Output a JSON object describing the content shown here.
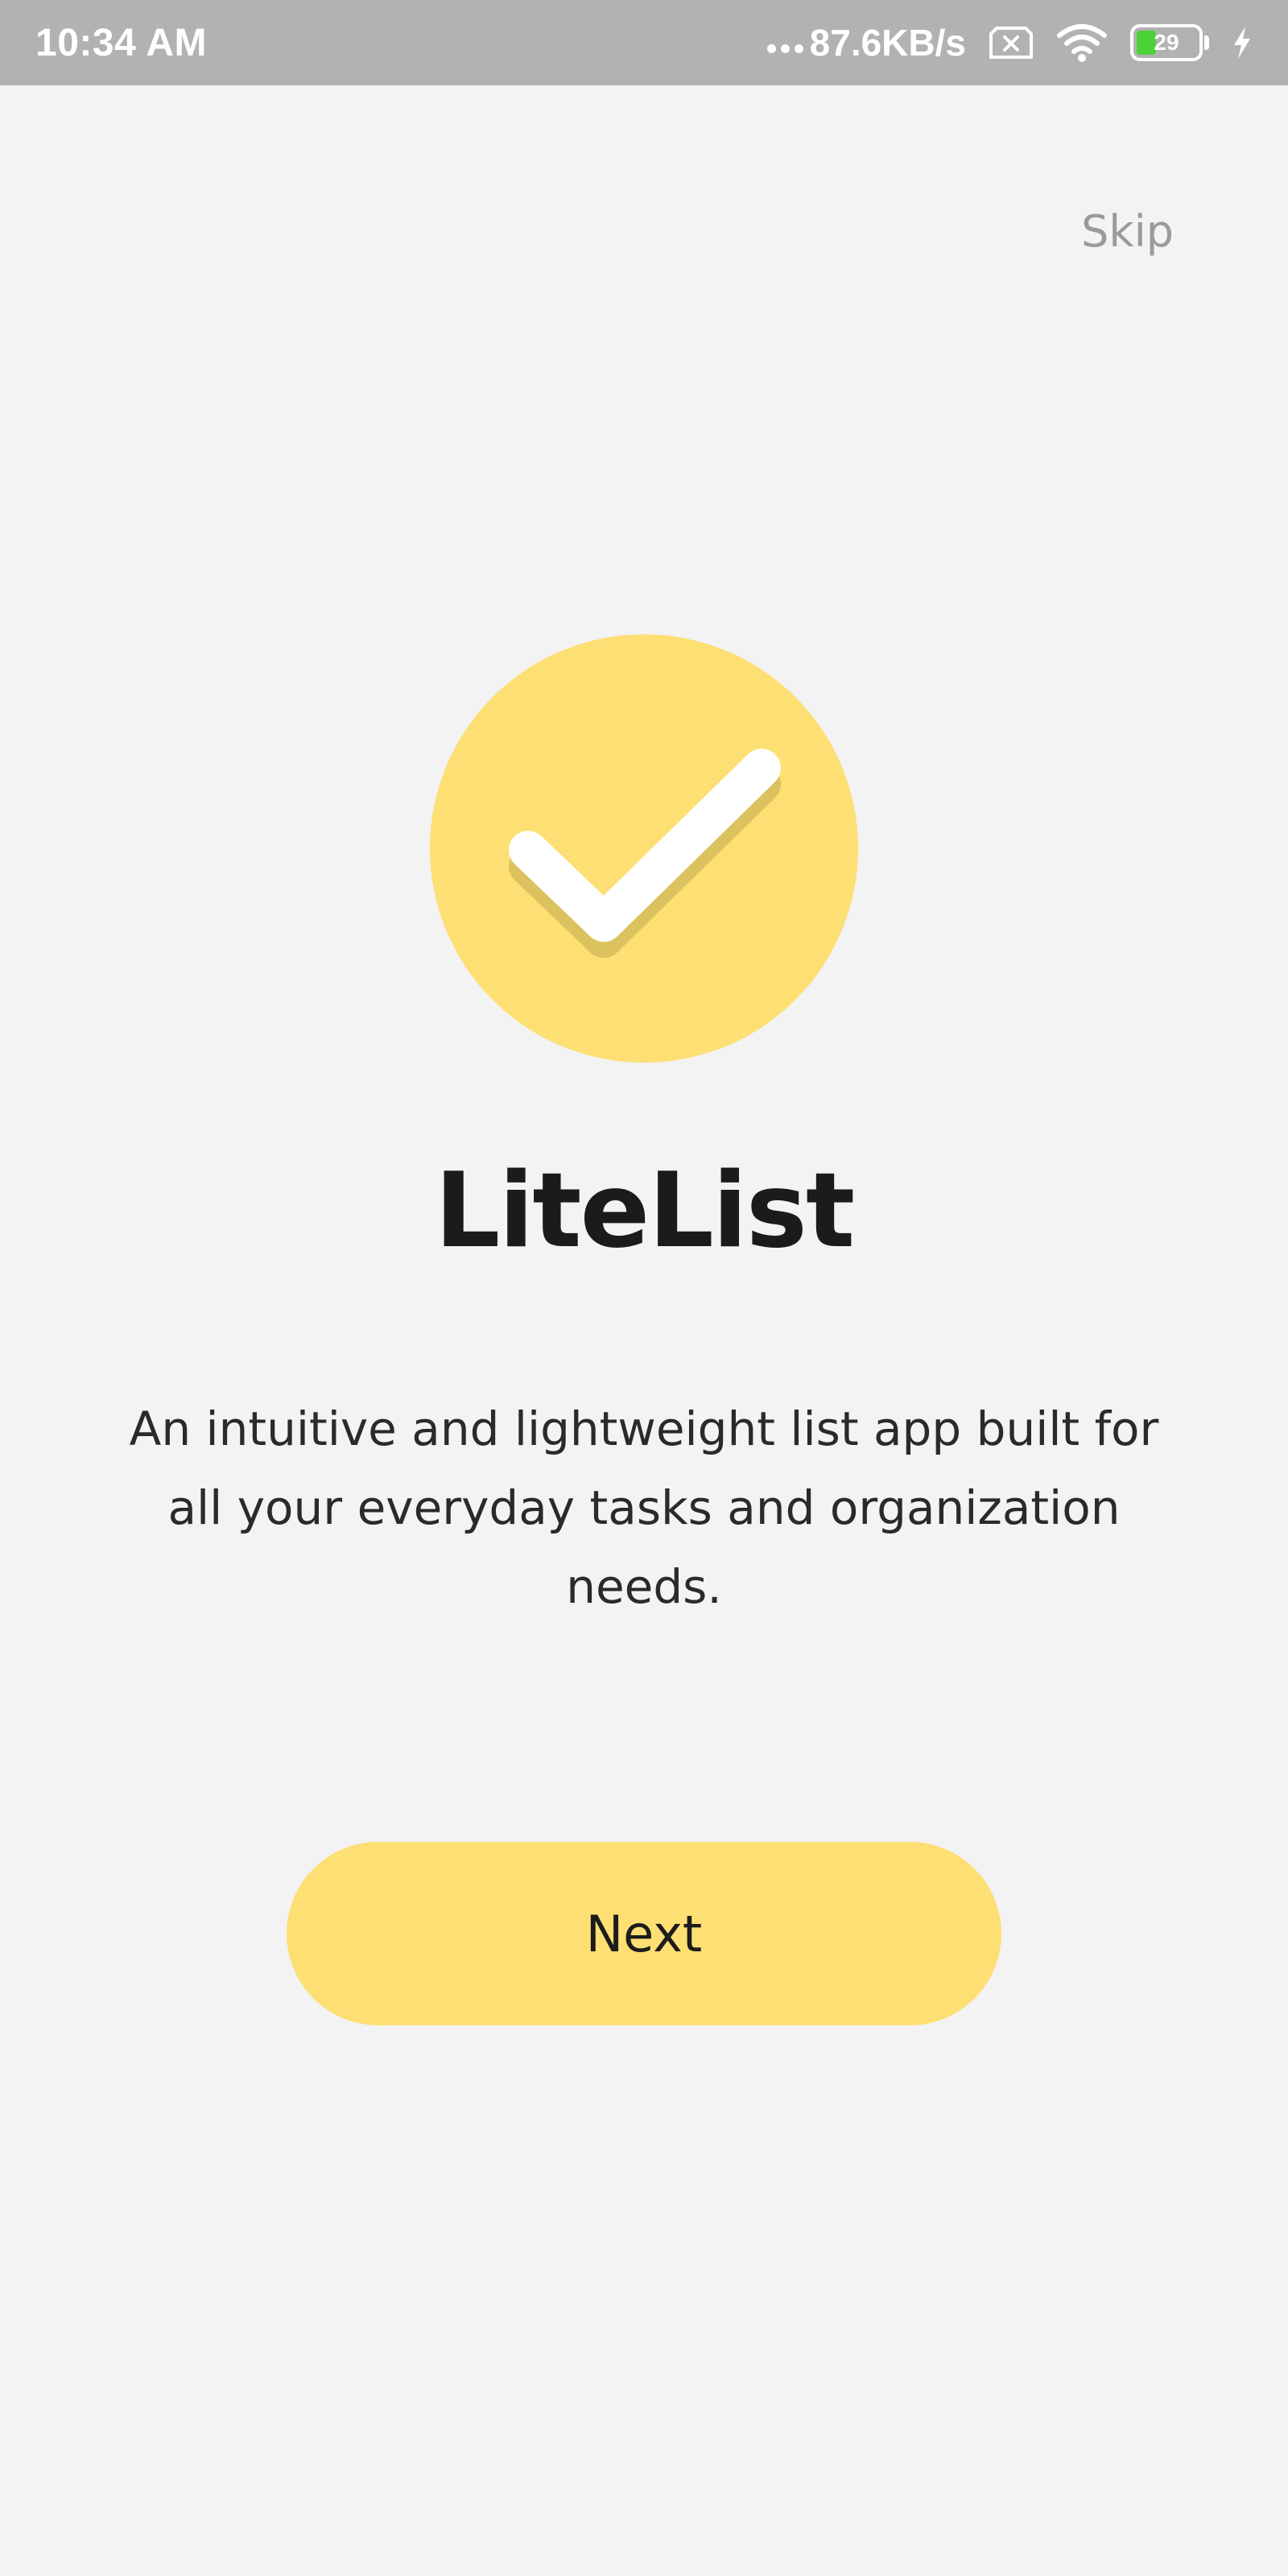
{
  "status_bar": {
    "time": "10:34 AM",
    "network_speed": "87.6KB/s",
    "battery_level": "29",
    "battery_percent": 29
  },
  "onboarding": {
    "skip_label": "Skip",
    "app_title": "LiteList",
    "description": "An intuitive and lightweight list app built for all your everyday tasks and organization needs.",
    "next_label": "Next"
  },
  "colors": {
    "accent": "#fddf73",
    "logo_shadow": "#dcc25e",
    "background": "#f3f3f3",
    "status_bar": "#b2b2b2"
  },
  "icons": {
    "logo": "checkmark-icon",
    "sim": "no-sim-icon",
    "wifi": "wifi-icon",
    "battery": "battery-icon",
    "charging": "charging-bolt-icon"
  }
}
